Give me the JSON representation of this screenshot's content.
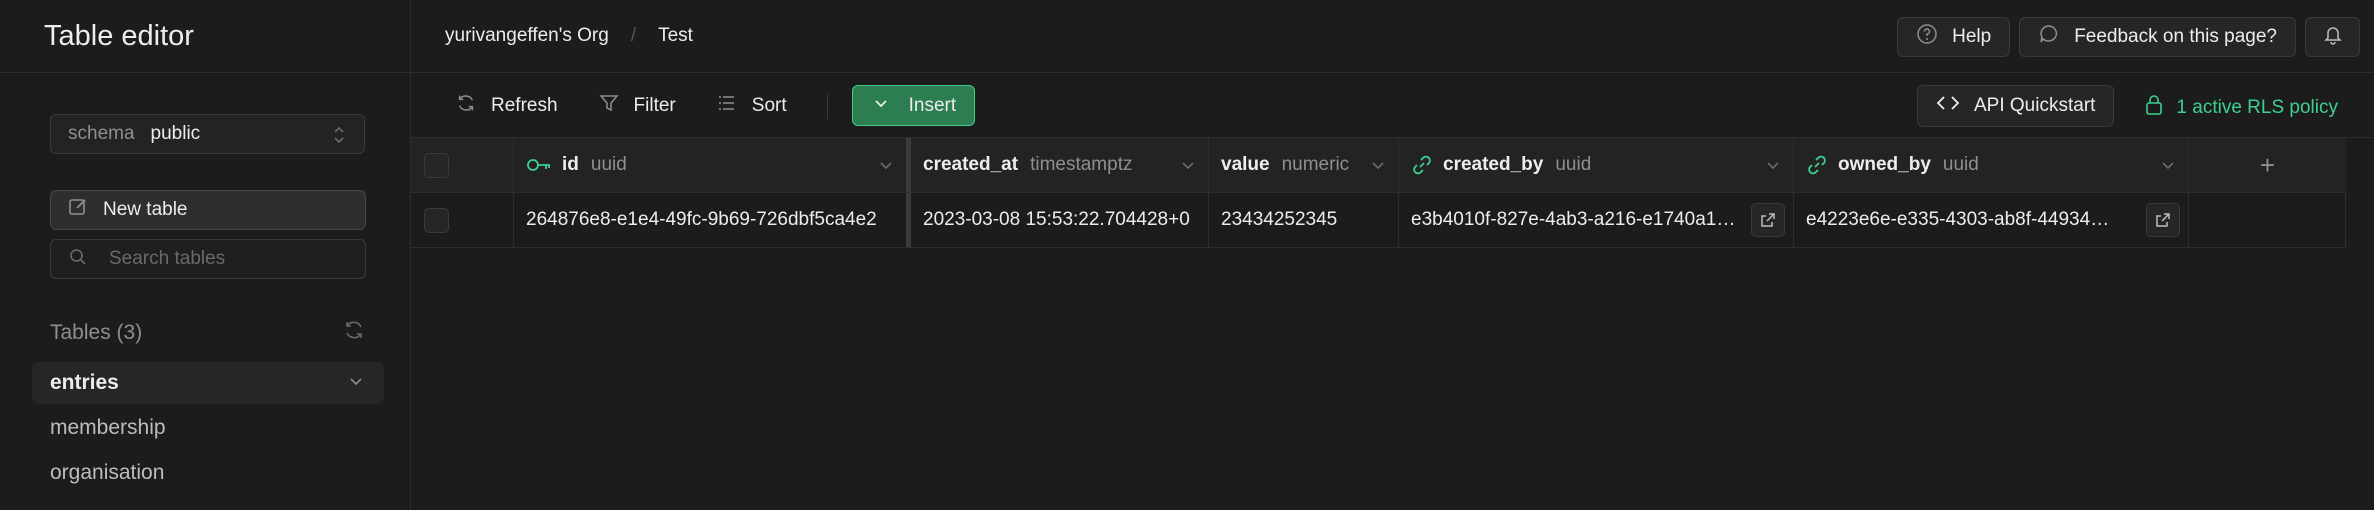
{
  "sidebar": {
    "title": "Table editor",
    "schema": {
      "label": "schema",
      "value": "public"
    },
    "new_table_label": "New table",
    "search_placeholder": "Search tables",
    "tables_heading": "Tables (3)",
    "tables": [
      {
        "label": "entries",
        "active": true
      },
      {
        "label": "membership",
        "active": false
      },
      {
        "label": "organisation",
        "active": false
      }
    ]
  },
  "topbar": {
    "breadcrumb": [
      "yurivangeffen's Org",
      "Test"
    ],
    "separator": "/",
    "help_label": "Help",
    "feedback_label": "Feedback on this page?"
  },
  "toolbar": {
    "refresh_label": "Refresh",
    "filter_label": "Filter",
    "sort_label": "Sort",
    "insert_label": "Insert",
    "api_label": "API Quickstart",
    "rls_label": "1 active RLS policy"
  },
  "grid": {
    "columns": [
      {
        "name": "id",
        "type": "uuid",
        "icon": "key-icon"
      },
      {
        "name": "created_at",
        "type": "timestamptz",
        "icon": ""
      },
      {
        "name": "value",
        "type": "numeric",
        "icon": ""
      },
      {
        "name": "created_by",
        "type": "uuid",
        "icon": "link-icon"
      },
      {
        "name": "owned_by",
        "type": "uuid",
        "icon": "link-icon"
      }
    ],
    "rows": [
      {
        "id": "264876e8-e1e4-49fc-9b69-726dbf5ca4e2",
        "created_at": "2023-03-08 15:53:22.704428+0",
        "value": "23434252345",
        "created_by": "e3b4010f-827e-4ab3-a216-e1740a1…",
        "owned_by": "e4223e6e-e335-4303-ab8f-44934…"
      }
    ],
    "add_column_label": "+"
  },
  "colors": {
    "background": "#1c1c1c",
    "accent": "#3ecf8e",
    "insert_button": "#2c7d4f"
  }
}
